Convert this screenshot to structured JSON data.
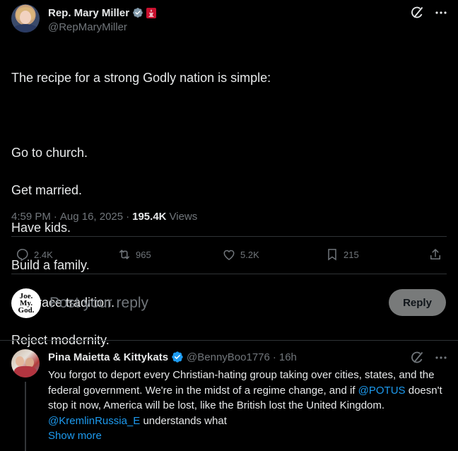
{
  "post": {
    "author": {
      "name": "Rep. Mary Miller",
      "handle": "@RepMaryMiller"
    },
    "lines": [
      "The recipe for a strong Godly nation is simple:",
      "",
      "Go to church.",
      "Get married.",
      "Have kids.",
      "Build a family.",
      "Embrace tradition.",
      "Reject modernity."
    ],
    "time": "4:59 PM",
    "date": "Aug 16, 2025",
    "separator": "·",
    "views_count": "195.4K",
    "views_label": "Views",
    "stats": {
      "replies": "2.4K",
      "reposts": "965",
      "likes": "5.2K",
      "bookmarks": "215"
    }
  },
  "composer": {
    "logo_lines": [
      "Joe.",
      "My.",
      "God."
    ],
    "placeholder": "Post your reply",
    "reply_label": "Reply"
  },
  "reply": {
    "name": "Pina Maietta & Kittykats",
    "handle": "@BennyBoo1776",
    "separator": "·",
    "time": "16h",
    "text_1": "You forgot to deport every Christian-hating group taking over cities, states, and the federal government. We're in the midst of a regime change, and if ",
    "mention_1": "@POTUS",
    "text_2": " doesn't stop it now, America will be lost, like the British lost the United Kingdom. ",
    "mention_2": "@KremlinRussia_E",
    "text_3": " understands what",
    "show_more": "Show more"
  },
  "colors": {
    "background": "#000000",
    "text": "#e7e9ea",
    "muted": "#71767b",
    "accent": "#1d9bf0",
    "divider": "#2f3336",
    "reply_button": "#787a7a",
    "gov_badge": "#c8102e"
  },
  "icons": [
    "verified-badge-icon",
    "government-badge-icon",
    "grok-icon",
    "more-icon",
    "reply-icon",
    "repost-icon",
    "like-icon",
    "bookmark-icon",
    "share-icon"
  ]
}
